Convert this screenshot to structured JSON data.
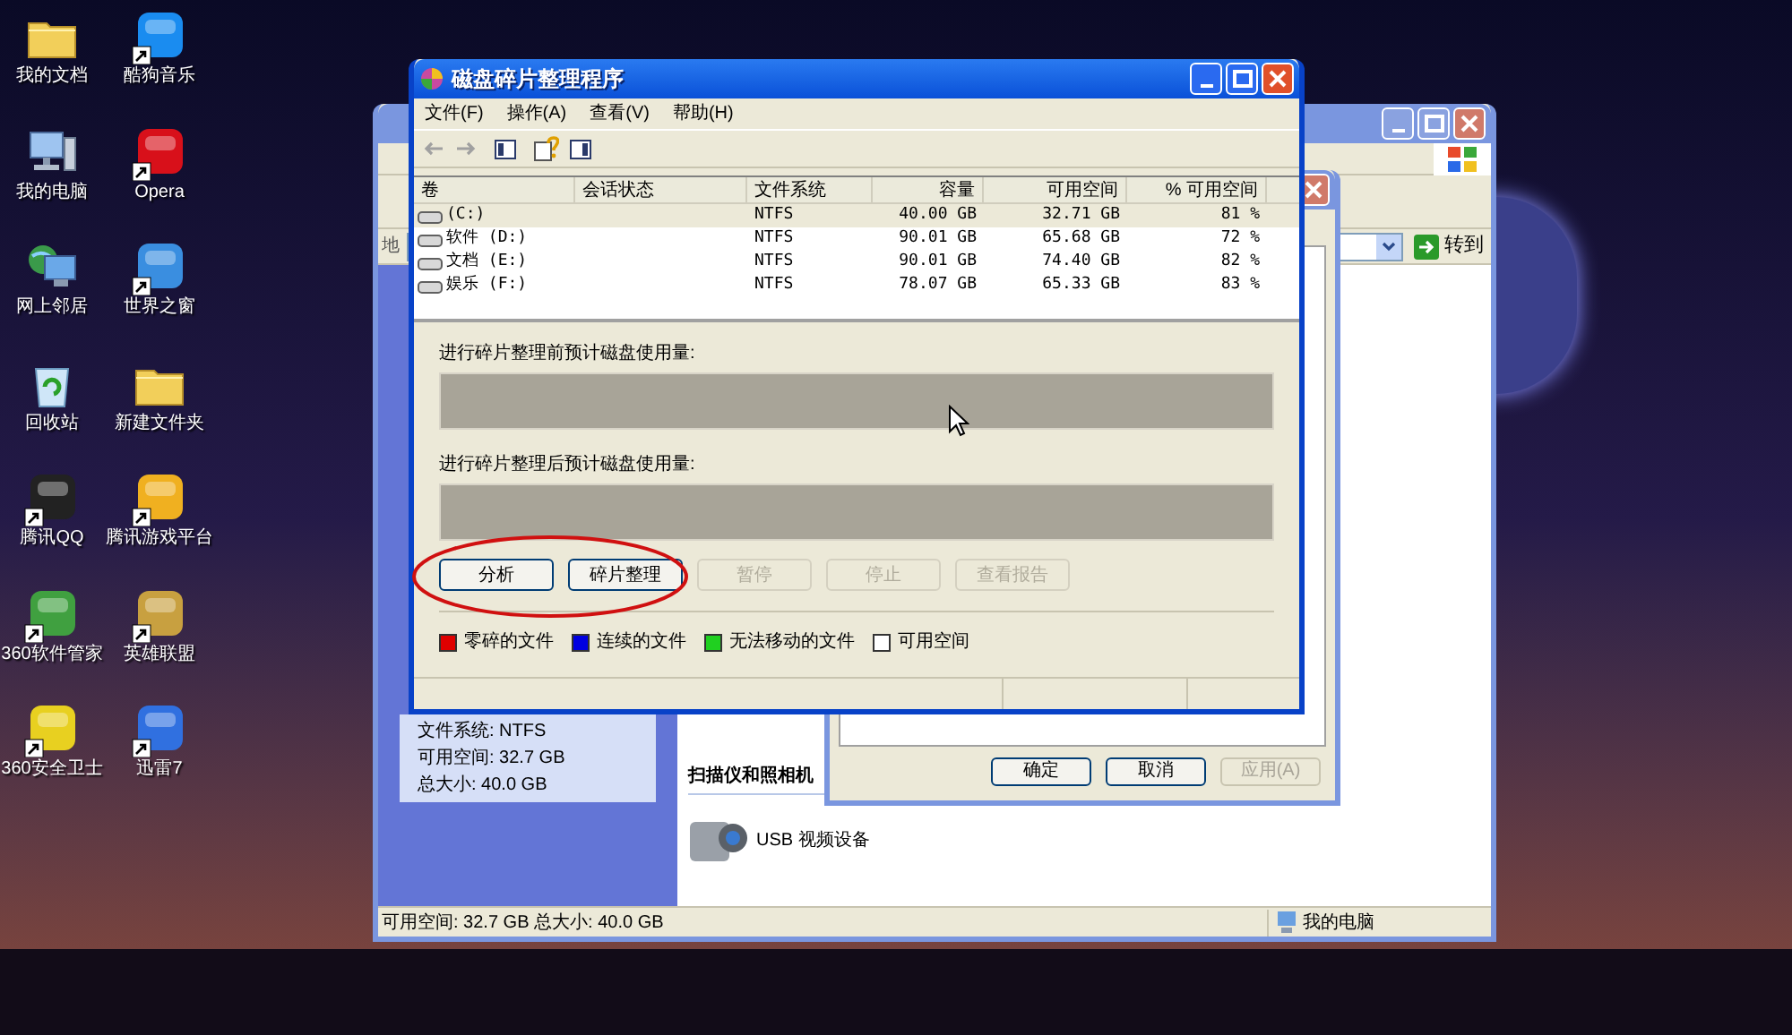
{
  "desktop_icons": [
    {
      "label": "我的文档",
      "kind": "folder",
      "shortcut": false
    },
    {
      "label": "酷狗音乐",
      "kind": "app",
      "color": "#1a8cf0",
      "shortcut": true
    },
    {
      "label": "我的电脑",
      "kind": "computer",
      "shortcut": false
    },
    {
      "label": "Opera",
      "kind": "app",
      "color": "#d8101a",
      "shortcut": true
    },
    {
      "label": "网上邻居",
      "kind": "network",
      "shortcut": false
    },
    {
      "label": "世界之窗",
      "kind": "app",
      "color": "#3a8ee0",
      "shortcut": true
    },
    {
      "label": "回收站",
      "kind": "bin",
      "shortcut": false
    },
    {
      "label": "新建文件夹",
      "kind": "folder",
      "shortcut": false
    },
    {
      "label": "腾讯QQ",
      "kind": "app",
      "color": "#222222",
      "shortcut": true
    },
    {
      "label": "腾讯游戏平台",
      "kind": "app",
      "color": "#f0b020",
      "shortcut": true
    },
    {
      "label": "360软件管家",
      "kind": "app",
      "color": "#40a040",
      "shortcut": true
    },
    {
      "label": "英雄联盟",
      "kind": "app",
      "color": "#c8a040",
      "shortcut": true
    },
    {
      "label": "360安全卫士",
      "kind": "app",
      "color": "#e8d020",
      "shortcut": true
    },
    {
      "label": "迅雷7",
      "kind": "app",
      "color": "#3070e0",
      "shortcut": true
    }
  ],
  "explorer_window": {
    "address_label": "地",
    "go_button": "转到",
    "sidebar_details": [
      "文件系统: NTFS",
      "可用空间: 32.7 GB",
      "总大小: 40.0 GB"
    ],
    "section_heading": "扫描仪和照相机",
    "devices": [
      {
        "label": "USB 视频设备"
      }
    ],
    "status_bar": {
      "summary": "可用空间: 32.7 GB 总大小: 40.0 GB",
      "location": "我的电脑"
    }
  },
  "properties_dialog": {
    "buttons": [
      {
        "label": "确定",
        "disabled": false
      },
      {
        "label": "取消",
        "disabled": false
      },
      {
        "label": "应用(A)",
        "disabled": true
      }
    ]
  },
  "defrag_window": {
    "title": "磁盘碎片整理程序",
    "menu": [
      "文件(F)",
      "操作(A)",
      "查看(V)",
      "帮助(H)"
    ],
    "columns": [
      "卷",
      "会话状态",
      "文件系统",
      "容量",
      "可用空间",
      "% 可用空间"
    ],
    "rows": [
      {
        "volume": "(C:)",
        "file_system": "NTFS",
        "capacity": "40.00 GB",
        "free": "32.71 GB",
        "percent": "81 %",
        "selected": true
      },
      {
        "volume": "软件 (D:)",
        "file_system": "NTFS",
        "capacity": "90.01 GB",
        "free": "65.68 GB",
        "percent": "72 %",
        "selected": false
      },
      {
        "volume": "文档 (E:)",
        "file_system": "NTFS",
        "capacity": "90.01 GB",
        "free": "74.40 GB",
        "percent": "82 %",
        "selected": false
      },
      {
        "volume": "娱乐 (F:)",
        "file_system": "NTFS",
        "capacity": "78.07 GB",
        "free": "65.33 GB",
        "percent": "83 %",
        "selected": false
      }
    ],
    "before_label": "进行碎片整理前预计磁盘使用量:",
    "after_label": "进行碎片整理后预计磁盘使用量:",
    "buttons": [
      {
        "label": "分析",
        "disabled": false
      },
      {
        "label": "碎片整理",
        "disabled": false
      },
      {
        "label": "暂停",
        "disabled": true
      },
      {
        "label": "停止",
        "disabled": true
      },
      {
        "label": "查看报告",
        "disabled": true
      }
    ],
    "legend": [
      {
        "label": "零碎的文件",
        "color": "#e00000"
      },
      {
        "label": "连续的文件",
        "color": "#0000e0"
      },
      {
        "label": "无法移动的文件",
        "color": "#20d020"
      },
      {
        "label": "可用空间",
        "color": "#ffffff"
      }
    ]
  }
}
